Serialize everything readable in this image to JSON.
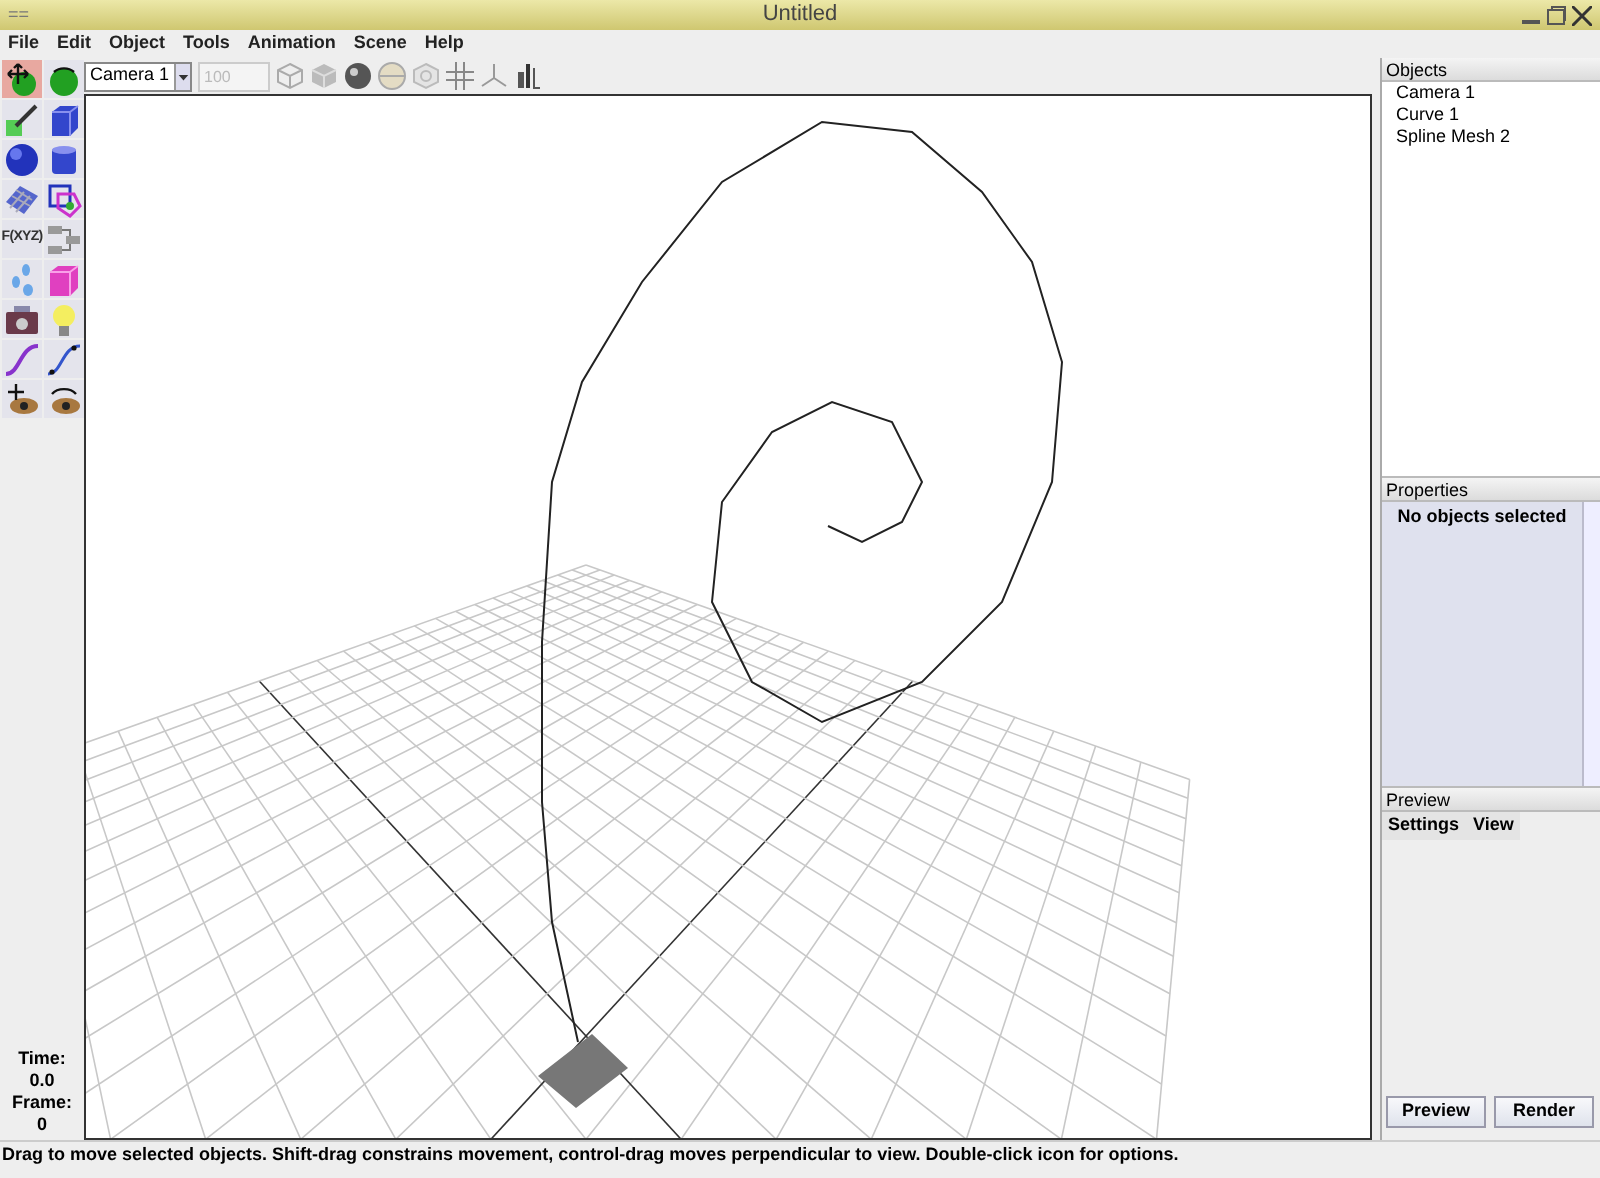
{
  "window": {
    "menu_glyph": "==",
    "title": "Untitled"
  },
  "menu": [
    "File",
    "Edit",
    "Object",
    "Tools",
    "Animation",
    "Scene",
    "Help"
  ],
  "toolbar": {
    "camera": "Camera 1",
    "frame_field": {
      "value": "100",
      "disabled": true
    }
  },
  "tools": [
    {
      "selected": true
    },
    {
      "selected": false
    },
    {
      "selected": false
    },
    {
      "selected": false
    },
    {
      "selected": false
    },
    {
      "selected": false
    },
    {
      "selected": false
    },
    {
      "selected": false
    },
    {
      "selected": false,
      "label": "F(XYZ)"
    },
    {
      "selected": false
    },
    {
      "selected": false
    },
    {
      "selected": false
    },
    {
      "selected": false
    },
    {
      "selected": false
    },
    {
      "selected": false
    },
    {
      "selected": false
    },
    {
      "selected": false
    },
    {
      "selected": false
    }
  ],
  "time": {
    "time_label": "Time:",
    "time": "0.0",
    "frame_label": "Frame:",
    "frame": "0"
  },
  "objects": {
    "title": "Objects",
    "items": [
      "Camera 1",
      "Curve 1",
      "Spline Mesh 2"
    ]
  },
  "properties": {
    "title": "Properties",
    "message": "No objects selected"
  },
  "preview": {
    "title": "Preview",
    "tabs": [
      "Settings",
      "View"
    ],
    "buttons": [
      "Preview",
      "Render"
    ]
  },
  "status_bar": "Drag to move selected objects.  Shift-drag constrains movement, control-drag moves perpendicular to view.  Double-click icon for options."
}
